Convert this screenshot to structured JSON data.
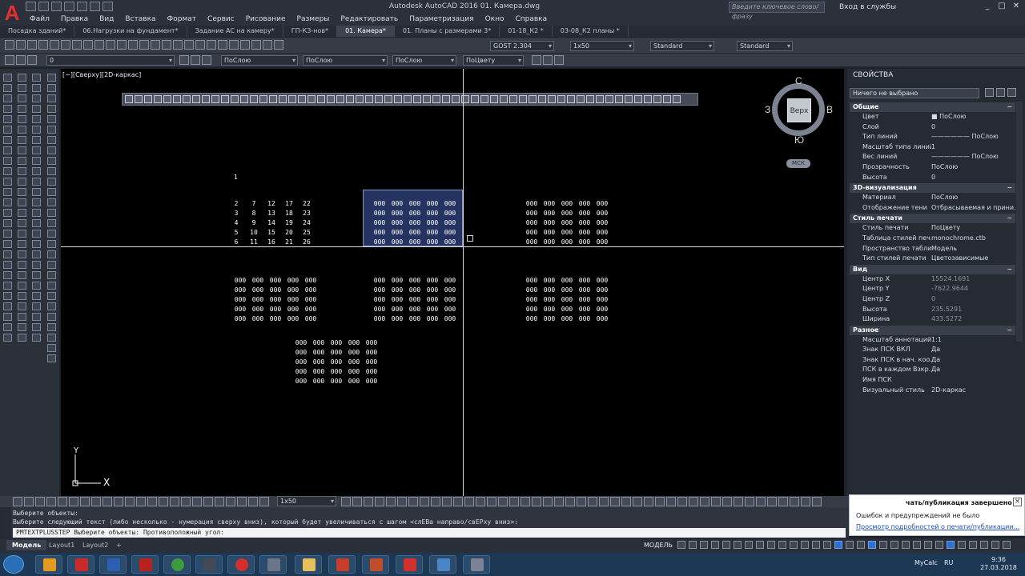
{
  "window": {
    "title": "Autodesk AutoCAD 2016    01. Камера.dwg",
    "search_placeholder": "Введите ключевое слово/фразу",
    "login": "Вход в службы"
  },
  "menu": [
    "Файл",
    "Правка",
    "Вид",
    "Вставка",
    "Формат",
    "Сервис",
    "Рисование",
    "Размеры",
    "Редактировать",
    "Параметризация",
    "Окно",
    "Справка"
  ],
  "file_tabs": [
    {
      "label": "Посадка зданий*",
      "active": false
    },
    {
      "label": "06.Нагрузки на фундамент*",
      "active": false
    },
    {
      "label": "Задание АС на камеру*",
      "active": false
    },
    {
      "label": "ГП-КЗ-нов*",
      "active": false
    },
    {
      "label": "01. Камера*",
      "active": true
    },
    {
      "label": "01. Планы с размерами 3*",
      "active": false
    },
    {
      "label": "01-18_К2 *",
      "active": false
    },
    {
      "label": "03-08_К2 планы *",
      "active": false
    }
  ],
  "toolbar": {
    "text_style": "GOST 2.304",
    "dim_scale": "1x50",
    "table_style": "Standard",
    "multileader_style": "Standard",
    "layer": "0",
    "color": "ПоСлою",
    "linetype": "ПоСлою",
    "lineweight": "ПоСлою",
    "plot_style": "ПоЦвету",
    "scale_combo": "1x50"
  },
  "viewport": {
    "label": "[−][Сверху][2D-каркас]"
  },
  "viewcube": {
    "top": "Верх",
    "north": "С",
    "south": "Ю",
    "east": "В",
    "west": "З",
    "wcs": "МСК"
  },
  "drawing": {
    "single_number": "1",
    "numbers_block": [
      [
        "2",
        "7",
        "12",
        "17",
        "22"
      ],
      [
        "3",
        "8",
        "13",
        "18",
        "23"
      ],
      [
        "4",
        "9",
        "14",
        "19",
        "24"
      ],
      [
        "5",
        "10",
        "15",
        "20",
        "25"
      ],
      [
        "6",
        "11",
        "16",
        "21",
        "26"
      ]
    ],
    "zero_cell": "000",
    "ucs_x": "X",
    "ucs_y": "Y"
  },
  "properties": {
    "title": "СВОЙСТВА",
    "selection": "Ничего не выбрано",
    "sections": [
      {
        "name": "Общие",
        "rows": [
          {
            "k": "Цвет",
            "v": "■ ПоСлою"
          },
          {
            "k": "Слой",
            "v": "0"
          },
          {
            "k": "Тип линий",
            "v": "—————— ПоСлою"
          },
          {
            "k": "Масштаб типа линий",
            "v": "1"
          },
          {
            "k": "Вес линий",
            "v": "—————— ПоСлою"
          },
          {
            "k": "Прозрачность",
            "v": "ПоСлою"
          },
          {
            "k": "Высота",
            "v": "0"
          }
        ]
      },
      {
        "name": "3D-визуализация",
        "rows": [
          {
            "k": "Материал",
            "v": "ПоСлою"
          },
          {
            "k": "Отображение тени",
            "v": "Отбрасываемая и прини..."
          }
        ]
      },
      {
        "name": "Стиль печати",
        "rows": [
          {
            "k": "Стиль печати",
            "v": "ПоЦвету"
          },
          {
            "k": "Таблица стилей печ...",
            "v": "monochrome.ctb"
          },
          {
            "k": "Пространство табли...",
            "v": "Модель"
          },
          {
            "k": "Тип стилей печати",
            "v": "Цветозависимые"
          }
        ]
      },
      {
        "name": "Вид",
        "rows": [
          {
            "k": "Центр X",
            "v": "15524.1691"
          },
          {
            "k": "Центр Y",
            "v": "-7622.9644"
          },
          {
            "k": "Центр Z",
            "v": "0"
          },
          {
            "k": "Высота",
            "v": "235.5291"
          },
          {
            "k": "Ширина",
            "v": "433.5272"
          }
        ]
      },
      {
        "name": "Разное",
        "rows": [
          {
            "k": "Масштаб аннотаций",
            "v": "1:1"
          },
          {
            "k": "Знак ПСК ВКЛ",
            "v": "Да"
          },
          {
            "k": "Знак ПСК в нач. коо...",
            "v": "Да"
          },
          {
            "k": "ПСК в каждом Взкр...",
            "v": "Да"
          },
          {
            "k": "Имя ПСК",
            "v": ""
          },
          {
            "k": "Визуальный стиль",
            "v": "2D-каркас"
          }
        ]
      }
    ]
  },
  "command": {
    "line1": "Выберите объекты:",
    "line2": "Выберите следующий текст (либо несколько - нумерация сверху вниз), который будет увеличиваться с шагом <слЕВа направо/свЕРху вниз>:",
    "prompt": "PMTEXTPLUSSTEP Выберите объекты: Противоположный угол:",
    "scale": "1x50"
  },
  "notification": {
    "title": "чать/публикация завершено",
    "message": "Ошибок и предупреждений не было",
    "link": "Просмотр подробностей о печати/публикации..."
  },
  "layouts": [
    "Модель",
    "Layout1",
    "Layout2",
    "+"
  ],
  "status": {
    "model": "МОДЕЛЬ",
    "annotation_scale": "1:1"
  },
  "taskbar": {
    "app": "MyCalc",
    "language": "RU",
    "time": "9:36",
    "date": "27.03.2018"
  },
  "colors": {
    "canvas": "#000000",
    "selection_fill": "#24335f",
    "selection_border": "#8796c9",
    "ui_dark": "#262a33",
    "accent_red": "#e03030"
  }
}
